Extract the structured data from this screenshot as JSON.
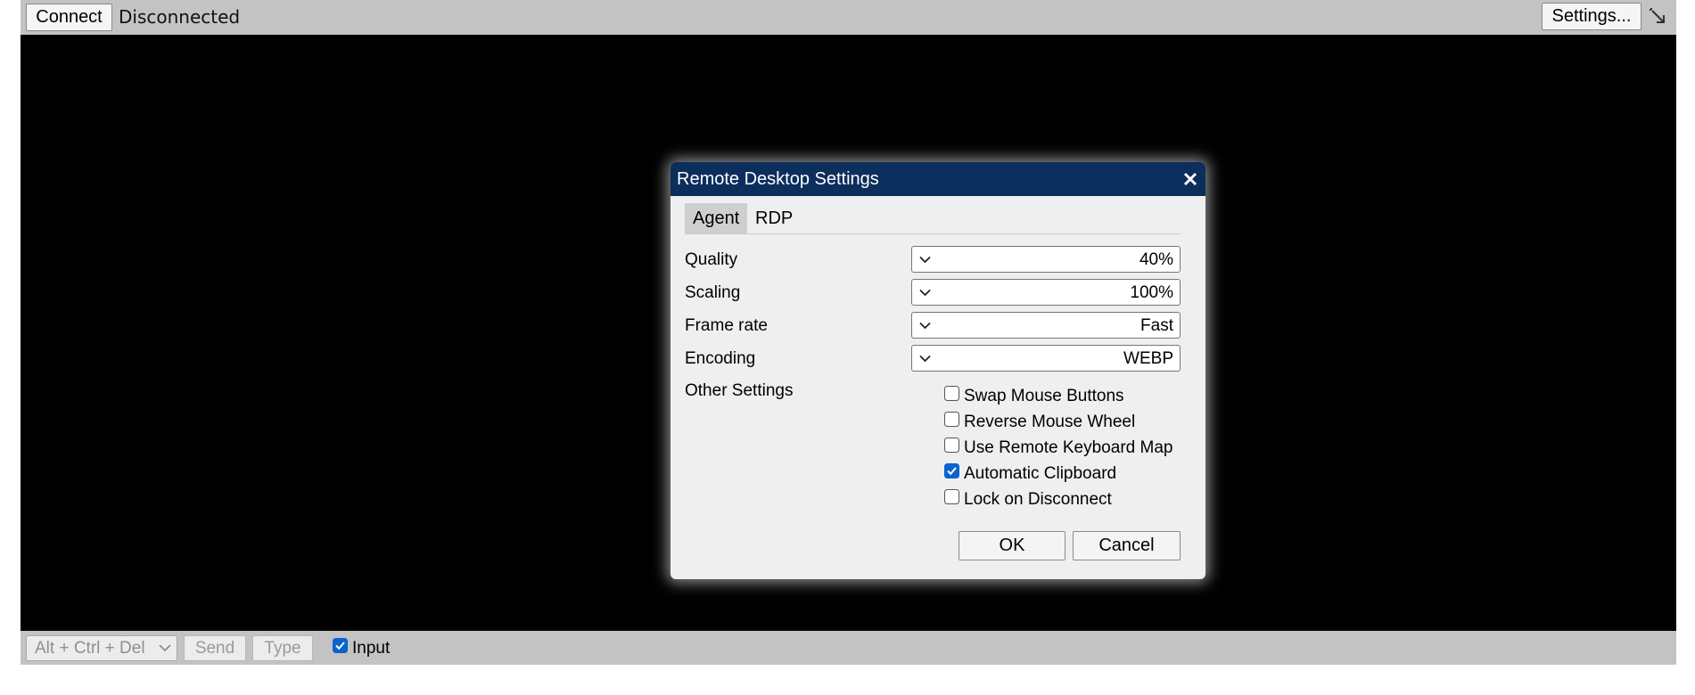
{
  "top_bar": {
    "connect_label": "Connect",
    "status": "Disconnected",
    "settings_label": "Settings..."
  },
  "bottom_bar": {
    "key_combo_selected": "Alt + Ctrl + Del",
    "send_label": "Send",
    "type_label": "Type",
    "input_label": "Input",
    "input_checked": true
  },
  "dialog": {
    "title": "Remote Desktop Settings",
    "tabs": [
      {
        "label": "Agent",
        "active": true
      },
      {
        "label": "RDP",
        "active": false
      }
    ],
    "settings": [
      {
        "label": "Quality",
        "value": "40%"
      },
      {
        "label": "Scaling",
        "value": "100%"
      },
      {
        "label": "Frame rate",
        "value": "Fast"
      },
      {
        "label": "Encoding",
        "value": "WEBP"
      }
    ],
    "other_settings_label": "Other Settings",
    "options": [
      {
        "label": "Swap Mouse Buttons",
        "checked": false
      },
      {
        "label": "Reverse Mouse Wheel",
        "checked": false
      },
      {
        "label": "Use Remote Keyboard Map",
        "checked": false
      },
      {
        "label": "Automatic Clipboard",
        "checked": true
      },
      {
        "label": "Lock on Disconnect",
        "checked": false
      }
    ],
    "ok_label": "OK",
    "cancel_label": "Cancel"
  },
  "colors": {
    "dialog_header": "#0b2e5c",
    "toolbar": "#c3c3c3",
    "canvas": "#000000",
    "checkbox_accent": "#0b63ce"
  },
  "icons": {
    "expand": "expand-arrow-icon",
    "close": "close-icon",
    "dropdown": "chevron-down-icon",
    "checkbox": "checkbox-icon"
  }
}
